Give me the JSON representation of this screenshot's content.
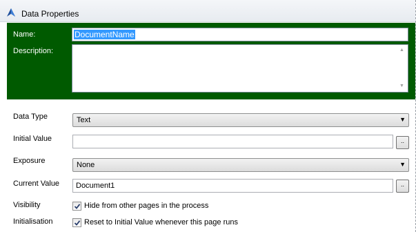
{
  "window": {
    "title": "Data Properties",
    "icon": "blue-arrow-icon"
  },
  "header": {
    "name_label": "Name:",
    "name_value": "DocumentName",
    "description_label": "Description:",
    "description_value": "",
    "panel_color": "#005a00"
  },
  "fields": {
    "data_type": {
      "label": "Data Type",
      "value": "Text"
    },
    "initial_value": {
      "label": "Initial Value",
      "value": "",
      "button": ".."
    },
    "exposure": {
      "label": "Exposure",
      "value": "None"
    },
    "current_value": {
      "label": "Current Value",
      "value": "Document1",
      "button": ".."
    },
    "visibility": {
      "label": "Visibility",
      "checkbox_label": "Hide from other pages in the process",
      "checked": true
    },
    "initialisation": {
      "label": "Initialisation",
      "checkbox_label": "Reset to Initial Value whenever this page runs",
      "checked": true
    }
  }
}
